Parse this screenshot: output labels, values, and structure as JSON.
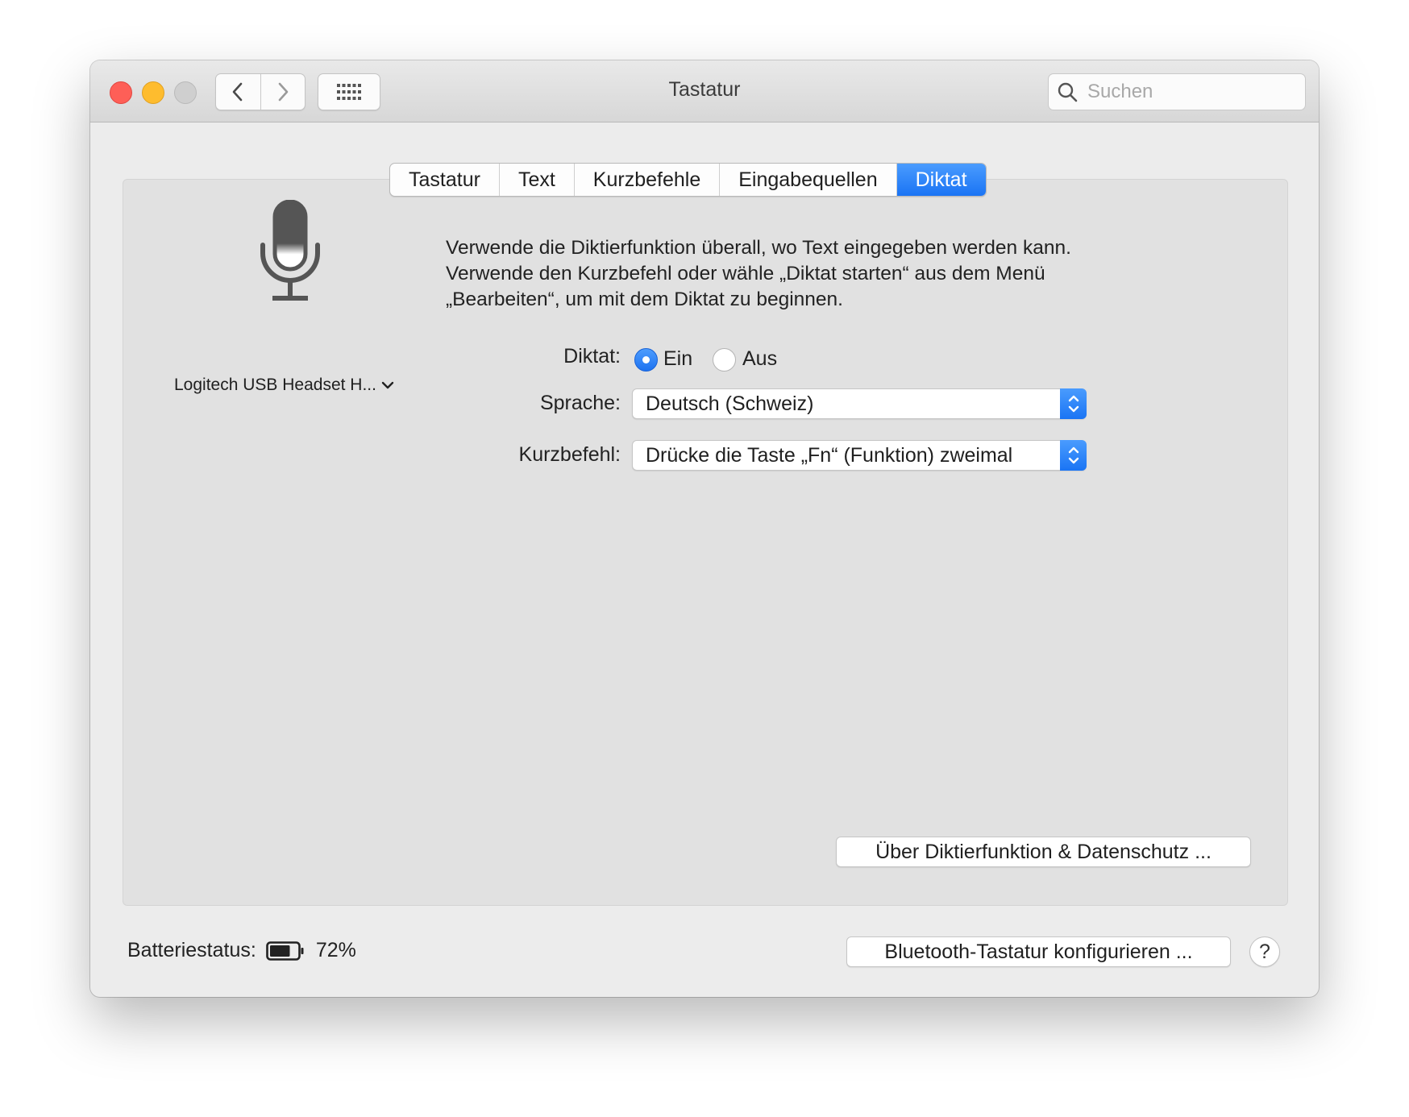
{
  "window": {
    "title": "Tastatur",
    "search_placeholder": "Suchen",
    "icons": {
      "close": "close-icon",
      "minimize": "minimize-icon",
      "maximize": "maximize-icon",
      "back": "chevron-left-icon",
      "forward": "chevron-right-icon",
      "grid": "grid-icon",
      "search": "search-icon"
    }
  },
  "tabs": [
    {
      "label": "Tastatur",
      "active": false
    },
    {
      "label": "Text",
      "active": false
    },
    {
      "label": "Kurzbefehle",
      "active": false
    },
    {
      "label": "Eingabequellen",
      "active": false
    },
    {
      "label": "Diktat",
      "active": true
    }
  ],
  "microphone": {
    "icon": "microphone-icon",
    "device_label": "Logitech USB Headset H..."
  },
  "description": [
    "Verwende die Diktierfunktion überall, wo Text eingegeben werden kann.",
    "Verwende den Kurzbefehl oder wähle „Diktat starten“ aus dem Menü",
    "„Bearbeiten“, um mit dem Diktat zu beginnen."
  ],
  "dictation": {
    "label": "Diktat:",
    "options": [
      "Ein",
      "Aus"
    ],
    "selected": "Ein"
  },
  "language": {
    "label": "Sprache:",
    "value": "Deutsch (Schweiz)"
  },
  "shortcut": {
    "label": "Kurzbefehl:",
    "value": "Drücke die Taste „Fn“ (Funktion) zweimal"
  },
  "buttons": {
    "privacy": "Über Diktierfunktion & Datenschutz ...",
    "bluetooth": "Bluetooth-Tastatur konfigurieren ...",
    "help": "?"
  },
  "battery": {
    "label": "Batteriestatus:",
    "percent_text": "72%",
    "level": 0.72
  },
  "colors": {
    "accent": "#1a74f4",
    "close": "#fe5f57",
    "minimize": "#febc2e"
  }
}
